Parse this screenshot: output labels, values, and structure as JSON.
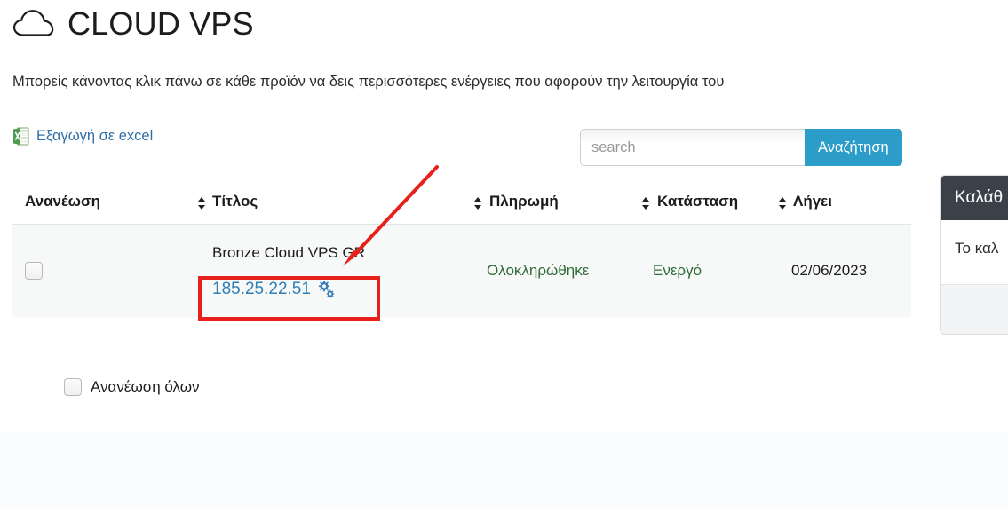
{
  "header": {
    "title": "CLOUD VPS",
    "cloud_icon": "cloud-icon",
    "subtitle": "Μπορείς κάνοντας κλικ πάνω σε κάθε προϊόν να δεις περισσότερες ενέργειες που αφορούν την λειτουργία του"
  },
  "toolbar": {
    "export_label": "Εξαγωγή σε excel",
    "export_icon": "excel-icon",
    "search_placeholder": "search",
    "search_value": "",
    "search_button_label": "Αναζήτηση"
  },
  "table": {
    "columns": [
      {
        "label": "Ανανέωση",
        "sortable": false
      },
      {
        "label": "Τίτλος",
        "sortable": true
      },
      {
        "label": "Πληρωμή",
        "sortable": true
      },
      {
        "label": "Κατάσταση",
        "sortable": true
      },
      {
        "label": "Λήγει",
        "sortable": true
      }
    ],
    "rows": [
      {
        "selected": false,
        "title": "Bronze Cloud VPS GR",
        "ip": "185.25.22.51",
        "ip_icon": "gears-icon",
        "payment": "Ολοκληρώθηκε",
        "status": "Ενεργό",
        "expires": "02/06/2023"
      }
    ]
  },
  "bulk": {
    "renew_all_label": "Ανανέωση όλων",
    "renew_all_checked": false
  },
  "cart": {
    "header": "Καλάθ",
    "body": "Το καλ"
  },
  "annotations": {
    "highlight_color": "#e8201c",
    "arrow_color": "#e8201c"
  },
  "colors": {
    "link": "#2f7fb5",
    "accent": "#2c9cc8",
    "success": "#2f6b38",
    "panel_header": "#3b4149"
  }
}
